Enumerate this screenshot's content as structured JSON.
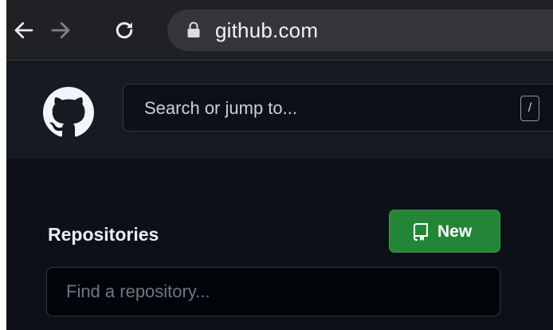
{
  "browser": {
    "url": "github.com"
  },
  "header": {
    "search_label": "Search or jump to...",
    "search_shortcut": "/"
  },
  "dashboard": {
    "repositories_title": "Repositories",
    "new_button_label": "New",
    "filter_placeholder": "Find a repository..."
  },
  "icons": {
    "back": "arrow-left-icon",
    "forward": "arrow-right-icon",
    "reload": "reload-icon",
    "lock": "lock-icon",
    "logo": "github-mark-icon",
    "new": "repo-book-icon"
  },
  "colors": {
    "primary_bg": "#0d1117",
    "header_bg": "#161b22",
    "border": "#30363d",
    "new_button_bg": "#238636",
    "browser_bar_bg": "#202124",
    "omnibox_bg": "#35363a"
  }
}
